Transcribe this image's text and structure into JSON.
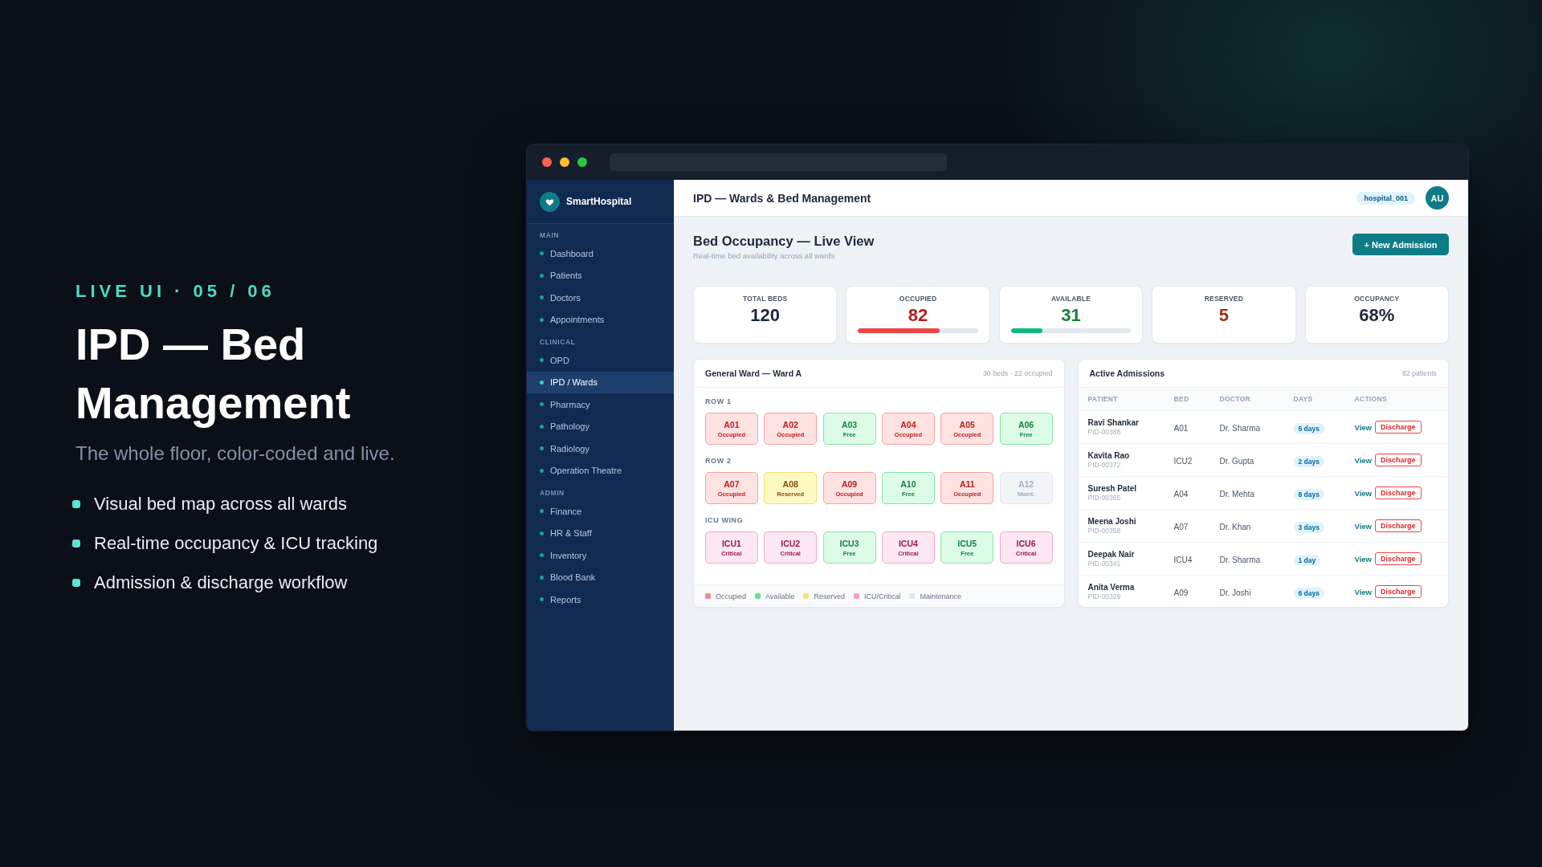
{
  "slide": {
    "eyebrow": "LIVE UI · 05 / 06",
    "title": "IPD — Bed Management",
    "subtitle": "The whole floor, color-coded and live.",
    "bullets": [
      "Visual bed map across all wards",
      "Real-time occupancy & ICU tracking",
      "Admission & discharge workflow"
    ]
  },
  "window": {
    "sidebar": {
      "brand": "SmartHospital",
      "sections": [
        {
          "label": "MAIN",
          "items": [
            {
              "label": "Dashboard",
              "selected": false
            },
            {
              "label": "Patients",
              "selected": false
            },
            {
              "label": "Doctors",
              "selected": false
            },
            {
              "label": "Appointments",
              "selected": false
            }
          ]
        },
        {
          "label": "CLINICAL",
          "items": [
            {
              "label": "OPD",
              "selected": false
            },
            {
              "label": "IPD / Wards",
              "selected": true
            },
            {
              "label": "Pharmacy",
              "selected": false
            },
            {
              "label": "Pathology",
              "selected": false
            },
            {
              "label": "Radiology",
              "selected": false
            },
            {
              "label": "Operation Theatre",
              "selected": false
            }
          ]
        },
        {
          "label": "ADMIN",
          "items": [
            {
              "label": "Finance",
              "selected": false
            },
            {
              "label": "HR & Staff",
              "selected": false
            },
            {
              "label": "Inventory",
              "selected": false
            },
            {
              "label": "Blood Bank",
              "selected": false
            },
            {
              "label": "Reports",
              "selected": false
            }
          ]
        }
      ]
    },
    "header": {
      "title": "IPD — Wards & Bed Management",
      "tenant": "hospital_001",
      "avatar_initials": "AU"
    },
    "page": {
      "title": "Bed Occupancy — Live View",
      "subtitle": "Real-time bed availability across all wards",
      "new_admission_button": "+ New Admission"
    },
    "stats": [
      {
        "label": "TOTAL BEDS",
        "value": "120",
        "kind": "total"
      },
      {
        "label": "OCCUPIED",
        "value": "82",
        "kind": "occupied",
        "level": 0.68
      },
      {
        "label": "AVAILABLE",
        "value": "31",
        "kind": "available",
        "level": 0.26
      },
      {
        "label": "RESERVED",
        "value": "5",
        "kind": "reserved"
      },
      {
        "label": "OCCUPANCY",
        "value": "68%",
        "kind": "occupancy"
      }
    ],
    "ward": {
      "title": "General Ward — Ward A",
      "summary": "30 beds · 22 occupied",
      "groups": [
        {
          "label": "ROW 1",
          "beds": [
            {
              "code": "A01",
              "status": "Occupied",
              "kind": "occupied"
            },
            {
              "code": "A02",
              "status": "Occupied",
              "kind": "occupied"
            },
            {
              "code": "A03",
              "status": "Free",
              "kind": "free"
            },
            {
              "code": "A04",
              "status": "Occupied",
              "kind": "occupied"
            },
            {
              "code": "A05",
              "status": "Occupied",
              "kind": "occupied"
            },
            {
              "code": "A06",
              "status": "Free",
              "kind": "free"
            }
          ]
        },
        {
          "label": "ROW 2",
          "beds": [
            {
              "code": "A07",
              "status": "Occupied",
              "kind": "occupied"
            },
            {
              "code": "A08",
              "status": "Reserved",
              "kind": "reserved"
            },
            {
              "code": "A09",
              "status": "Occupied",
              "kind": "occupied"
            },
            {
              "code": "A10",
              "status": "Free",
              "kind": "free"
            },
            {
              "code": "A11",
              "status": "Occupied",
              "kind": "occupied"
            },
            {
              "code": "A12",
              "status": "Maint.",
              "kind": "maintenance"
            }
          ]
        },
        {
          "label": "ICU WING",
          "beds": [
            {
              "code": "ICU1",
              "status": "Critical",
              "kind": "critical"
            },
            {
              "code": "ICU2",
              "status": "Critical",
              "kind": "critical"
            },
            {
              "code": "ICU3",
              "status": "Free",
              "kind": "free"
            },
            {
              "code": "ICU4",
              "status": "Critical",
              "kind": "critical"
            },
            {
              "code": "ICU5",
              "status": "Free",
              "kind": "free"
            },
            {
              "code": "ICU6",
              "status": "Critical",
              "kind": "critical"
            }
          ]
        }
      ],
      "legend": [
        {
          "label": "Occupied",
          "color": "#f28b8b"
        },
        {
          "label": "Available",
          "color": "#6adf95"
        },
        {
          "label": "Reserved",
          "color": "#fbe07a"
        },
        {
          "label": "ICU/Critical",
          "color": "#f59cc8"
        },
        {
          "label": "Maintenance",
          "color": "#e2e8f0"
        }
      ]
    },
    "admissions": {
      "title": "Active Admissions",
      "summary": "82 patients",
      "columns": [
        "PATIENT",
        "BED",
        "DOCTOR",
        "DAYS",
        "ACTIONS"
      ],
      "rows": [
        {
          "name": "Ravi Shankar",
          "pid": "PID-00388",
          "bed": "A01",
          "doctor": "Dr. Sharma",
          "days": "5 days",
          "view": "View",
          "discharge": "Discharge"
        },
        {
          "name": "Kavita Rao",
          "pid": "PID-00372",
          "bed": "ICU2",
          "doctor": "Dr. Gupta",
          "days": "2 days",
          "view": "View",
          "discharge": "Discharge"
        },
        {
          "name": "Suresh Patel",
          "pid": "PID-00365",
          "bed": "A04",
          "doctor": "Dr. Mehta",
          "days": "8 days",
          "view": "View",
          "discharge": "Discharge"
        },
        {
          "name": "Meena Joshi",
          "pid": "PID-00358",
          "bed": "A07",
          "doctor": "Dr. Khan",
          "days": "3 days",
          "view": "View",
          "discharge": "Discharge"
        },
        {
          "name": "Deepak Nair",
          "pid": "PID-00341",
          "bed": "ICU4",
          "doctor": "Dr. Sharma",
          "days": "1 day",
          "view": "View",
          "discharge": "Discharge"
        },
        {
          "name": "Anita Verma",
          "pid": "PID-00329",
          "bed": "A09",
          "doctor": "Dr. Joshi",
          "days": "6 days",
          "view": "View",
          "discharge": "Discharge"
        }
      ]
    }
  }
}
